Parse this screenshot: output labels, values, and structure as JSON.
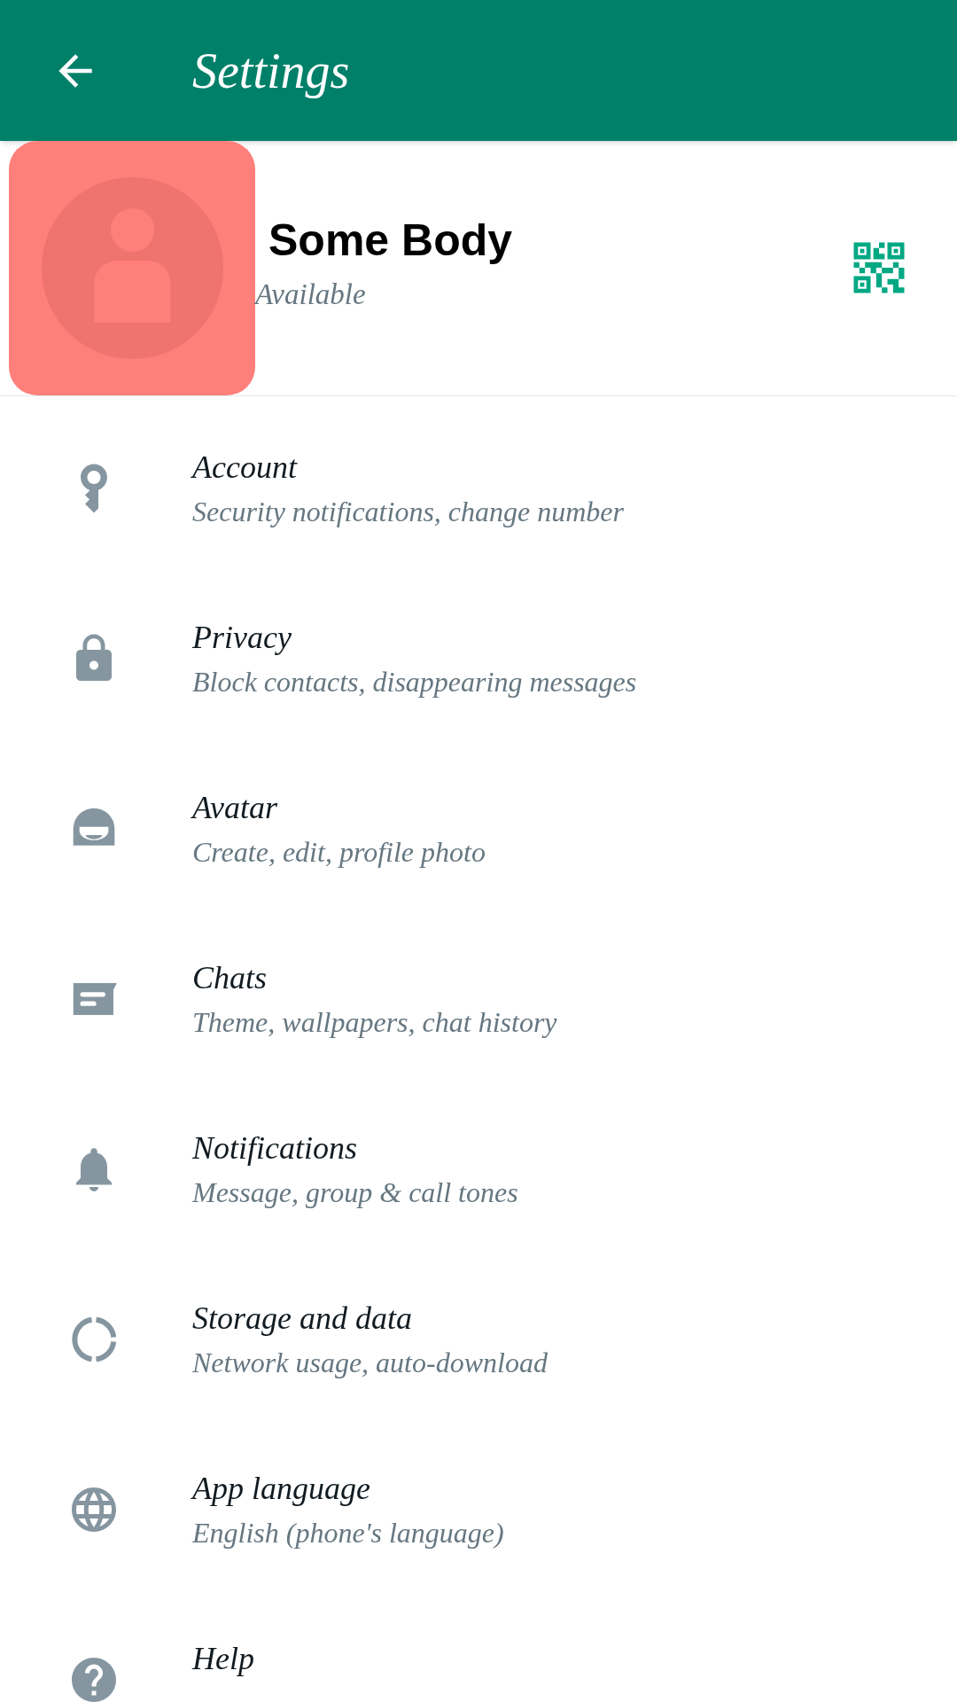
{
  "header": {
    "title": "Settings"
  },
  "profile": {
    "name": "Some Body",
    "status": "Available"
  },
  "items": [
    {
      "kind": "key",
      "title": "Account",
      "subtitle": "Security notifications, change number"
    },
    {
      "kind": "lock",
      "title": "Privacy",
      "subtitle": "Block contacts, disappearing messages"
    },
    {
      "kind": "avatar",
      "title": "Avatar",
      "subtitle": "Create, edit, profile photo"
    },
    {
      "kind": "chats",
      "title": "Chats",
      "subtitle": "Theme, wallpapers, chat history"
    },
    {
      "kind": "bell",
      "title": "Notifications",
      "subtitle": "Message, group & call tones"
    },
    {
      "kind": "storage",
      "title": "Storage and data",
      "subtitle": "Network usage, auto-download"
    },
    {
      "kind": "globe",
      "title": "App language",
      "subtitle": "English (phone's language)"
    },
    {
      "kind": "help",
      "title": "Help"
    }
  ]
}
